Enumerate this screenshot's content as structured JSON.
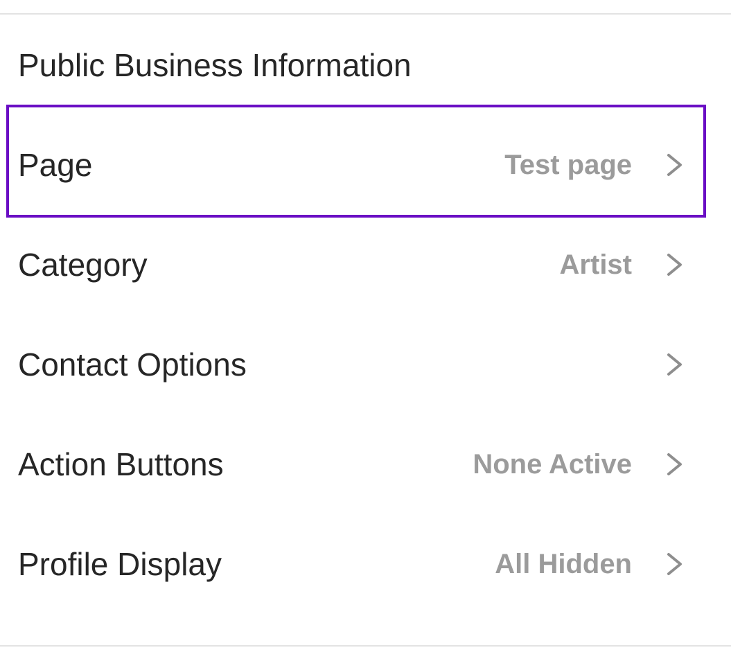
{
  "section": {
    "title": "Public Business Information"
  },
  "rows": [
    {
      "label": "Page",
      "value": "Test page"
    },
    {
      "label": "Category",
      "value": "Artist"
    },
    {
      "label": "Contact Options",
      "value": ""
    },
    {
      "label": "Action Buttons",
      "value": "None Active"
    },
    {
      "label": "Profile Display",
      "value": "All Hidden"
    }
  ],
  "icons": {
    "row_chevron": "chevron-right-icon"
  },
  "colors": {
    "highlight": "#6a0dc4",
    "label_text": "#262626",
    "value_text": "#9b9b9b",
    "divider": "#e3e3e3"
  }
}
